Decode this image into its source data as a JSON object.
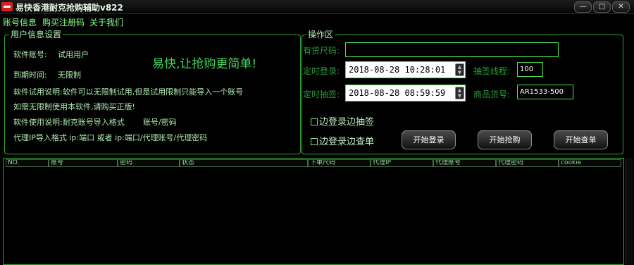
{
  "window": {
    "title": "易快香港耐克抢购辅助v822",
    "buttons": {
      "minimize": "—",
      "maximize": "□",
      "close": "✕"
    }
  },
  "menu": [
    "账号信息",
    "购买注册码",
    "关于我们"
  ],
  "user_info": {
    "group_title": "用户信息设置",
    "account_label": "软件账号:",
    "account_value": "试用用户",
    "expiry_label": "到期时间:",
    "expiry_value": "无限制",
    "trial_note": "软件试用说明:软件可以无限制试用,但是试用限制只能导入一个账号",
    "buy_note": "如需无限制使用本软件,请购买正版!",
    "usage_label": "软件使用说明:耐克账号导入格式",
    "usage_format": "账号/密码",
    "proxy_note": "代理IP导入格式  ip:端口  或者 ip:端口/代理账号/代理密码",
    "slogan": "易快,让抢购更简单!"
  },
  "operation": {
    "group_title": "操作区",
    "stock_size_label": "有货尺码:",
    "stock_size_value": "",
    "login_time_label": "定时登录:",
    "login_time_value": "2018-08-28 10:28:01",
    "draw_time_label": "定时抽签:",
    "draw_time_value": "2018-08-28 08:59:59",
    "threads_label": "抽签线程:",
    "threads_value": "100",
    "sku_label": "商品货号:",
    "sku_value": "AR1533-500",
    "check_draw": "边登录边抽签",
    "check_order": "边登录边查单",
    "btn_login": "开始登录",
    "btn_grab": "开始抢购",
    "btn_query": "开始查单"
  },
  "table": {
    "columns": [
      "NO.",
      "账号",
      "密码",
      "状态",
      "下单尺码",
      "代理IP",
      "代理账号",
      "代理密码",
      "cookie"
    ]
  }
}
